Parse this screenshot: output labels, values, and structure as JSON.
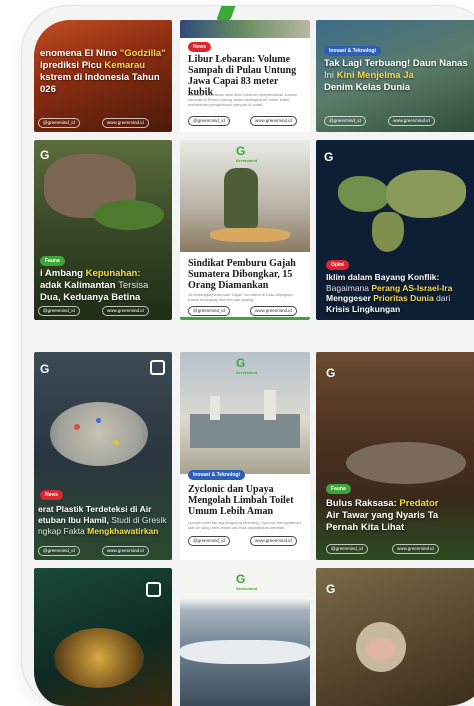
{
  "app": {
    "handle": "@greenmind_id",
    "site": "www.greenmind.id",
    "logo_letter": "G",
    "logo_sub": "Greenmind",
    "accent": "#3aa935"
  },
  "posts": [
    {
      "id": "p1",
      "title_parts": [
        "enomena El Nino ",
        "\"Godzilla\"",
        " iprediksi Picu ",
        "Kemarau",
        " kstrem di Indonesia Tahun 026"
      ]
    },
    {
      "id": "p2",
      "badge": "News",
      "title": "Libur Lebaran: Volume Sampah di Pulau Untung Jawa Capai 83 meter kubik",
      "desc": "Lonjakan wisatawan saat libur Lebaran menyebabkan volume sampah di Pulau Untung Jawa meningkat 83 meter kubik, membebani pengelolaan sampah di pulau."
    },
    {
      "id": "p3",
      "badge": "Inovasi & Teknologi",
      "title_parts": [
        "Tak Lagi Terbuang! Daun Nanas ",
        "Ini",
        " Kini Menjelma Ja",
        " Denim Kelas Dunia"
      ]
    },
    {
      "id": "p4",
      "badge": "Fauna",
      "title_parts": [
        "i Ambang ",
        "Kepunahan:",
        " adak Kalimantan ",
        "Tersisa",
        " Dua, Keduanya Betina"
      ]
    },
    {
      "id": "p5",
      "title": "Sindikat Pemburu Gajah Sumatera Dibongkar, 15 Orang Diamankan",
      "desc": "15 tersangka perburuan Gajah Sumatera di Riau ditangkap. Kasus terungkap dari temuan gading."
    },
    {
      "id": "p6",
      "badge": "Opini",
      "title_parts": [
        "Iklim dalam Bayang Konflik:",
        " Bagaimana ",
        "Perang AS-Israel-Ira",
        " Menggeser ",
        "Prioritas Dunia",
        " dari",
        " Krisis Lingkungan"
      ]
    },
    {
      "id": "p7",
      "badge": "News",
      "title_parts": [
        "erat Plastik Terdeteksi di Air ",
        "etuban Ibu Hamil,",
        " Studi di Gresik ",
        "ngkap Fakta ",
        "Mengkhawatirkan"
      ]
    },
    {
      "id": "p8",
      "badge": "Inovasi & Teknologi",
      "title": "Zyclonic dan Upaya Mengolah Limbah Toilet Umum Lebih Aman",
      "desc": "Limbah toilet tak lagi langsung terbuang. Zyclonic mengolahnya jadi air yang lebih aman dan bisa dijumlahkan kembali."
    },
    {
      "id": "p9",
      "badge": "Fauna",
      "title_parts": [
        "Bulus Raksasa: ",
        "Predator",
        " Air Tawar yang Nyaris Ta",
        " Pernah Kita Lihat"
      ]
    }
  ],
  "colors": {
    "red": "#d9282f",
    "blue": "#2f5fb4",
    "green": "#3fa53b",
    "yellow": "#f7d848"
  }
}
